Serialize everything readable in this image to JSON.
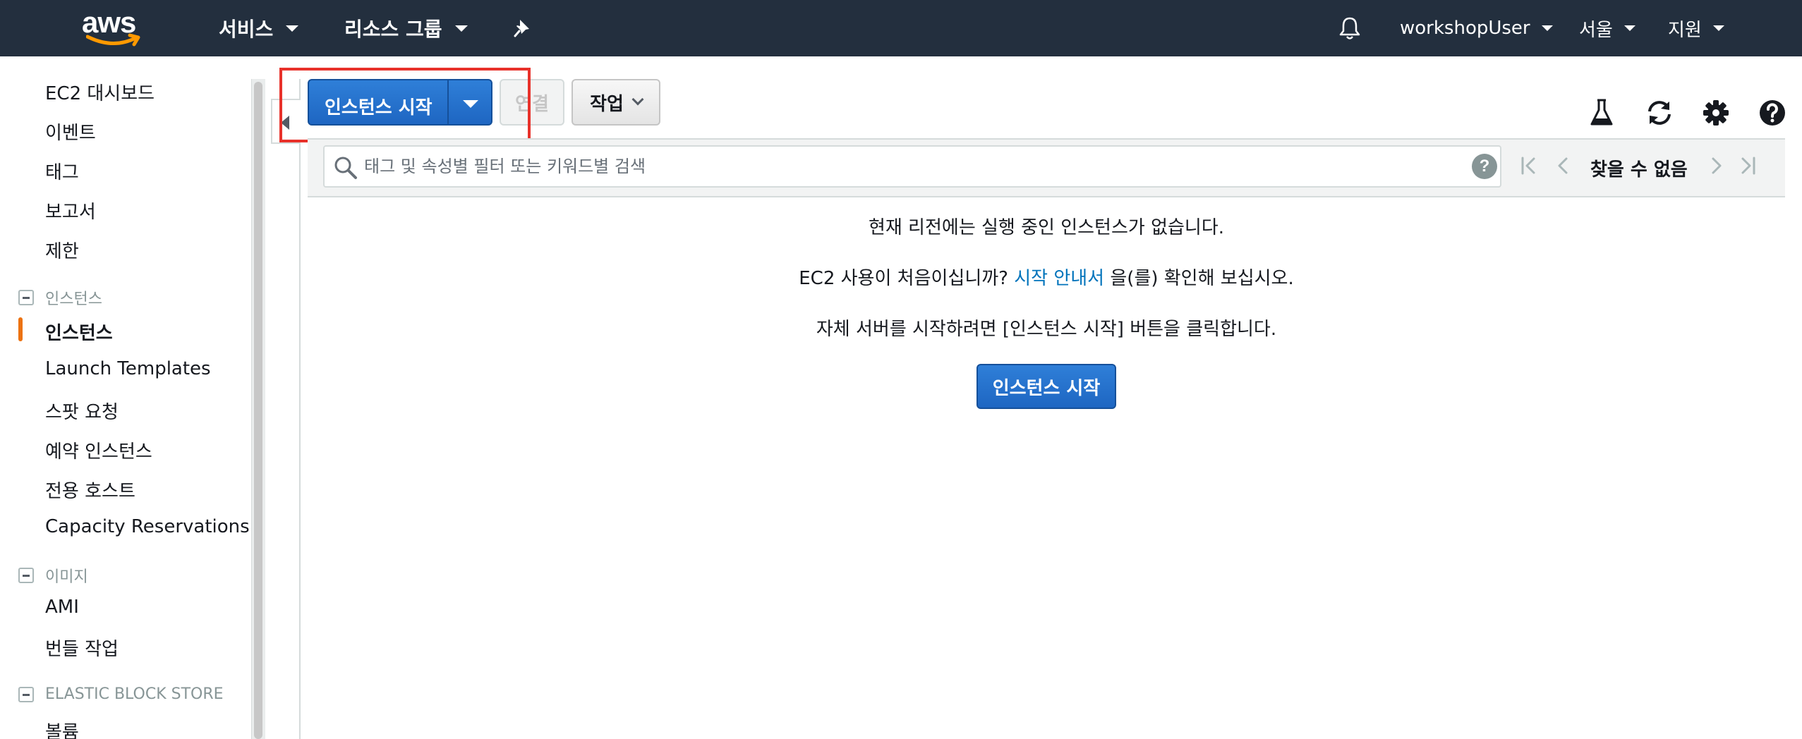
{
  "topnav": {
    "logo_text": "aws",
    "services_label": "서비스",
    "resource_groups_label": "리소스 그룹",
    "pin_icon": "pin-icon",
    "bell_icon": "bell-icon",
    "user_label": "workshopUser",
    "region_label": "서울",
    "support_label": "지원",
    "colors": {
      "background": "#232f3e",
      "smile": "#ff9900"
    }
  },
  "sidebar": {
    "items_top": [
      "EC2 대시보드",
      "이벤트",
      "태그",
      "보고서",
      "제한"
    ],
    "section_instances": {
      "header": "인스턴스",
      "items": [
        "인스턴스",
        "Launch Templates",
        "스팟 요청",
        "예약 인스턴스",
        "전용 호스트",
        "Capacity Reservations"
      ],
      "active": "인스턴스"
    },
    "section_images": {
      "header": "이미지",
      "items": [
        "AMI",
        "번들 작업"
      ]
    },
    "section_ebs": {
      "header": "ELASTIC BLOCK STORE",
      "items": [
        "볼륨"
      ]
    },
    "accent_color": "#ec7211"
  },
  "toolbar": {
    "launch_label": "인스턴스 시작",
    "connect_label": "연결",
    "actions_label": "작업",
    "icons": [
      "flask-icon",
      "refresh-icon",
      "gear-icon",
      "help-icon"
    ]
  },
  "filter": {
    "placeholder": "태그 및 속성별 필터 또는 키워드별 검색",
    "help_glyph": "?",
    "pager_text": "찾을 수 없음"
  },
  "empty_state": {
    "line1": "현재 리전에는 실행 중인 인스턴스가 없습니다.",
    "line2_pre": "EC2 사용이 처음이십니까?",
    "line2_link": "시작 안내서",
    "line2_post": "을(를) 확인해 보십시오.",
    "line3": "자체 서버를 시작하려면 [인스턴스 시작] 버튼을 클릭합니다.",
    "button_label": "인스턴스 시작"
  },
  "highlight_color": "#e8312a"
}
